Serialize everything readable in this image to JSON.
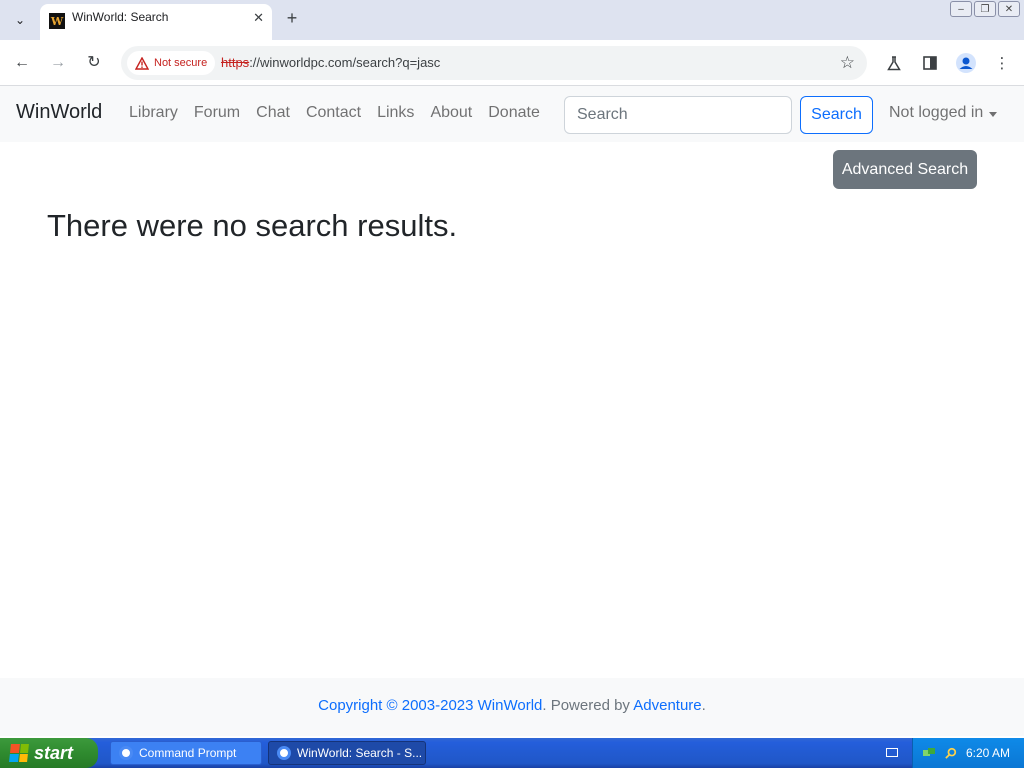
{
  "browser": {
    "tab_title": "WinWorld: Search",
    "favicon_letter": "W",
    "security_label": "Not secure",
    "url_scheme": "https",
    "url_rest": "://winworldpc.com/search?q=jasc"
  },
  "site": {
    "brand": "WinWorld",
    "nav_items": [
      "Library",
      "Forum",
      "Chat",
      "Contact",
      "Links",
      "About",
      "Donate"
    ],
    "search_placeholder": "Search",
    "search_button": "Search",
    "user_menu": "Not logged in",
    "advanced_search": "Advanced Search",
    "no_results_text": "There were no search results."
  },
  "footer": {
    "copyright": "Copyright © 2003-2023 WinWorld",
    "powered_by": ". Powered by ",
    "adventure": "Adventure",
    "period": "."
  },
  "taskbar": {
    "start_label": "start",
    "items": [
      {
        "label": "Command Prompt"
      },
      {
        "label": "WinWorld: Search - S..."
      }
    ],
    "clock": "6:20 AM"
  },
  "colors": {
    "link": "#0d6efd",
    "secondary_button": "#6c757d",
    "not_secure": "#c5221f"
  }
}
